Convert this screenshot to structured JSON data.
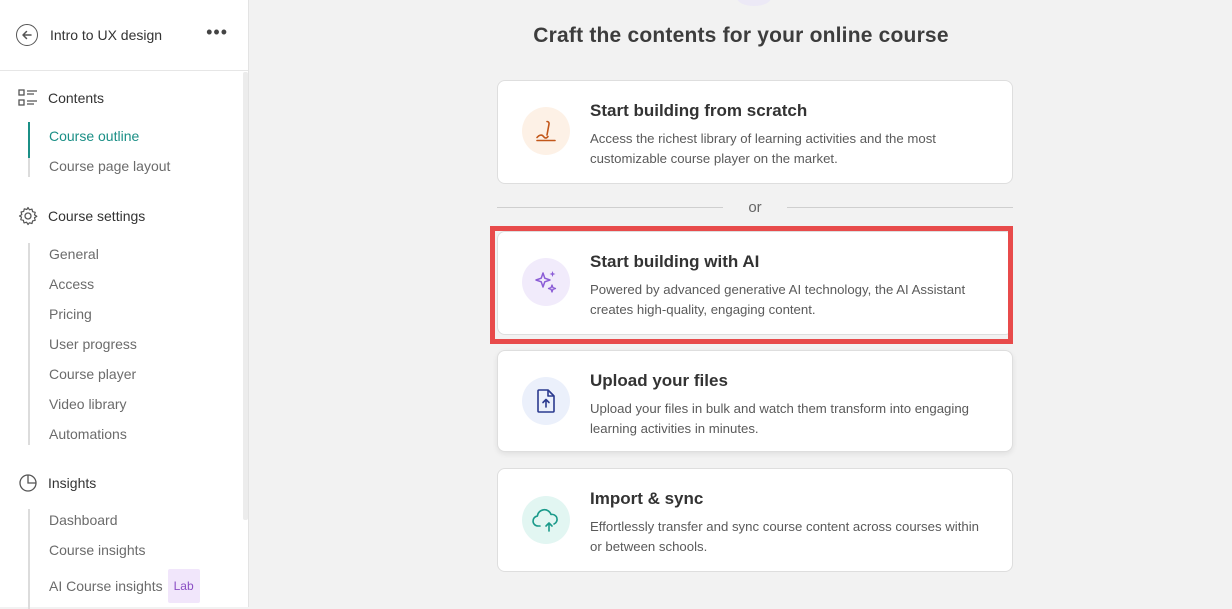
{
  "sidebar": {
    "title": "Intro to UX design",
    "more": "•••",
    "contents": {
      "label": "Contents",
      "items": [
        {
          "label": "Course outline",
          "active": true
        },
        {
          "label": "Course page layout",
          "active": false
        }
      ]
    },
    "settings": {
      "label": "Course settings",
      "items": [
        "General",
        "Access",
        "Pricing",
        "User progress",
        "Course player",
        "Video library",
        "Automations"
      ]
    },
    "insights": {
      "label": "Insights",
      "items": [
        "Dashboard",
        "Course insights",
        "AI Course insights"
      ],
      "badge": "Lab"
    }
  },
  "main": {
    "title": "Craft the contents for your online course",
    "or_label": "or",
    "cards": [
      {
        "title": "Start building from scratch",
        "desc": "Access the richest library of learning activities and the most customizable course player on the market.",
        "icon": "pencil-icon",
        "icon_bg": "#fdf1e6",
        "icon_color": "#c2571a"
      },
      {
        "title": "Start building with AI",
        "desc": "Powered by advanced generative AI technology, the AI Assistant creates high-quality, engaging content.",
        "icon": "sparkles-icon",
        "icon_bg": "#f1ebfb",
        "icon_color": "#8b5cd6"
      },
      {
        "title": "Upload your files",
        "desc": "Upload your files in bulk and watch them transform into engaging learning activities in minutes.",
        "icon": "file-upload-icon",
        "icon_bg": "#ebf0fb",
        "icon_color": "#2b3a8f"
      },
      {
        "title": "Import & sync",
        "desc": "Effortlessly transfer and sync course content across courses within or between schools.",
        "icon": "cloud-upload-icon",
        "icon_bg": "#e2f6f2",
        "icon_color": "#1a9a8a"
      }
    ],
    "highlight_color": "#e84b4b"
  }
}
